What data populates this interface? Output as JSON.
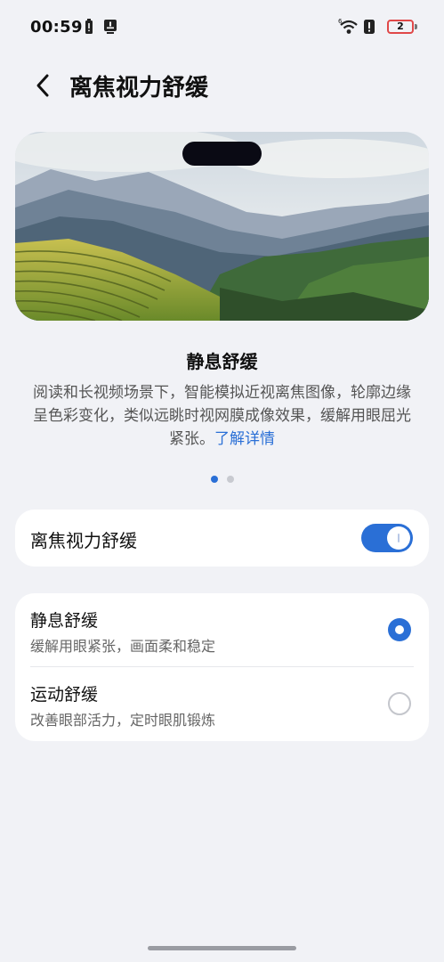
{
  "status_bar": {
    "time": "00:59",
    "battery_level": "2",
    "icons": [
      "battery-low-icon",
      "notification-icon",
      "wifi-icon",
      "alert-icon",
      "battery-icon"
    ]
  },
  "header": {
    "title": "离焦视力舒缓",
    "back_icon": "chevron-left-icon"
  },
  "carousel": {
    "image": "mountain-terrace-landscape",
    "mode_title": "静息舒缓",
    "description": "阅读和长视频场景下，智能模拟近视离焦图像，轮廓边缘呈色彩变化，类似远眺时视网膜成像效果，缓解用眼屈光紧张。",
    "learn_more": "了解详情",
    "page_count": 2,
    "current_page": 1
  },
  "toggle": {
    "label": "离焦视力舒缓",
    "enabled": true
  },
  "options": [
    {
      "title": "静息舒缓",
      "subtitle": "缓解用眼紧张，画面柔和稳定",
      "selected": true
    },
    {
      "title": "运动舒缓",
      "subtitle": "改善眼部活力，定时眼肌锻炼",
      "selected": false
    }
  ],
  "colors": {
    "accent": "#2a6fd6",
    "background": "#f1f2f6",
    "card": "#ffffff",
    "battery_warning": "#e04848"
  }
}
